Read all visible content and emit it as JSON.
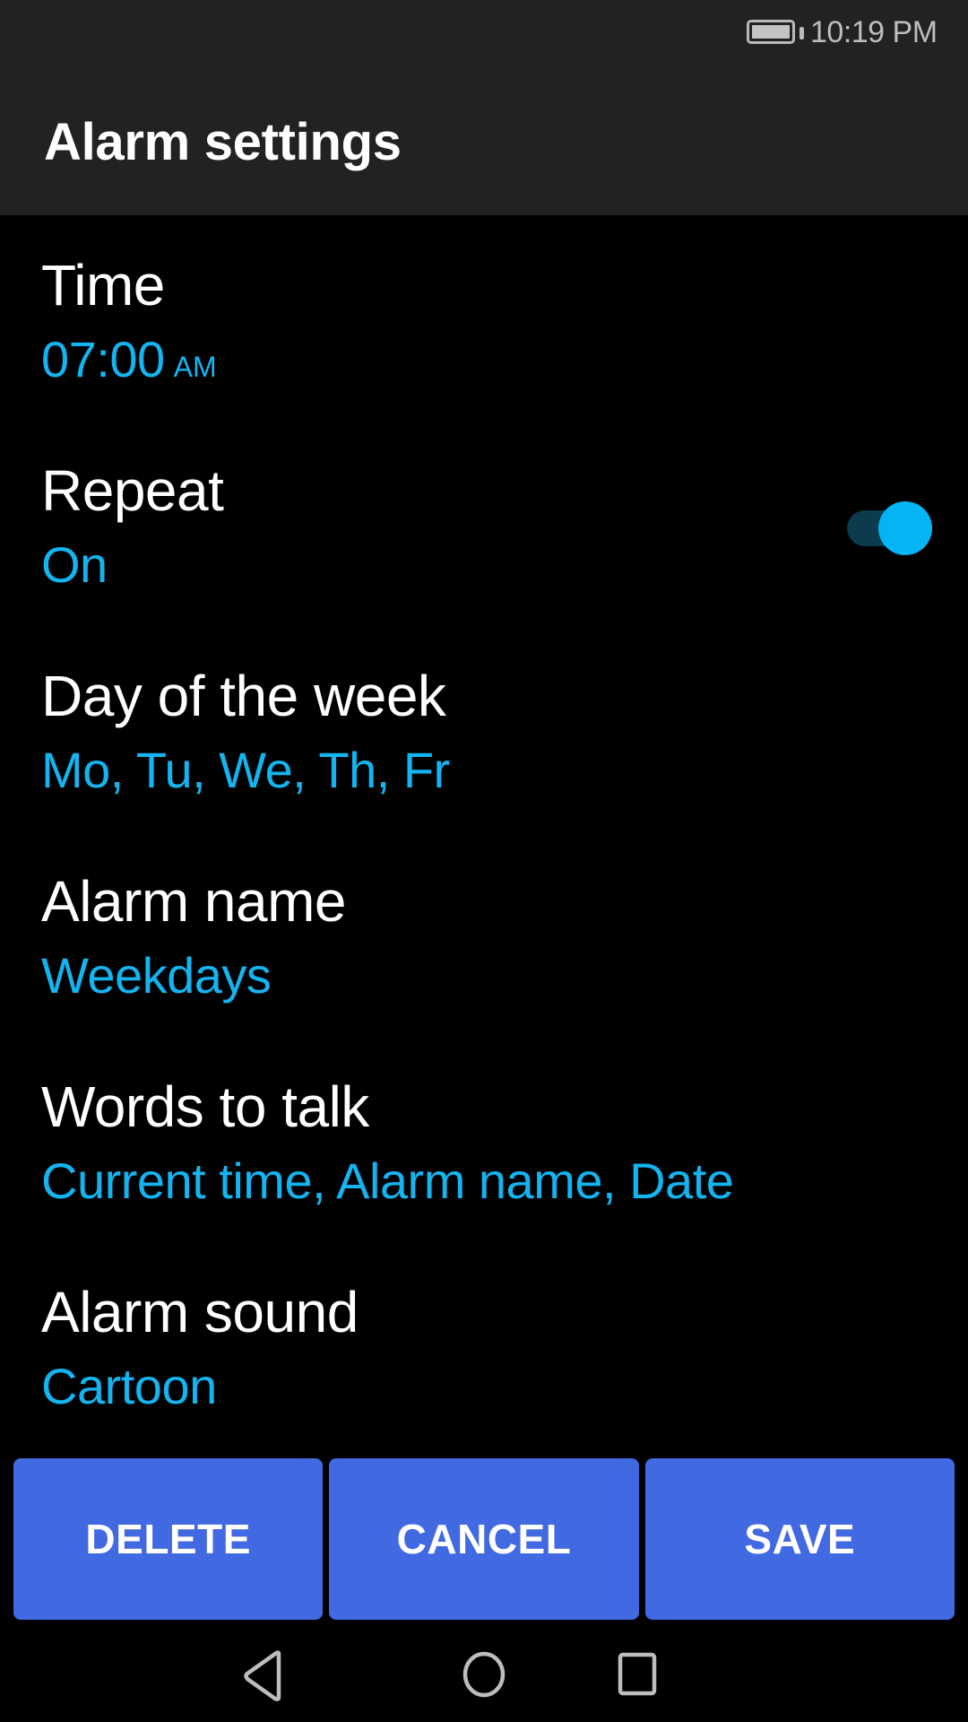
{
  "status_bar": {
    "battery_icon": "battery-full-icon",
    "time": "10:19 PM"
  },
  "app_bar": {
    "title": "Alarm settings"
  },
  "settings": [
    {
      "id": "time",
      "label": "Time",
      "value": "07:00",
      "suffix": "AM"
    },
    {
      "id": "repeat",
      "label": "Repeat",
      "value": "On",
      "toggle_on": true
    },
    {
      "id": "day-of-week",
      "label": "Day of the week",
      "value": "Mo, Tu, We, Th, Fr"
    },
    {
      "id": "alarm-name",
      "label": "Alarm name",
      "value": "Weekdays"
    },
    {
      "id": "words-to-talk",
      "label": "Words to talk",
      "value": "Current time, Alarm name, Date"
    },
    {
      "id": "alarm-sound",
      "label": "Alarm sound",
      "value": "Cartoon"
    }
  ],
  "actions": {
    "delete_label": "DELETE",
    "cancel_label": "CANCEL",
    "save_label": "SAVE"
  },
  "nav_bar": {
    "back_icon": "back-triangle-icon",
    "home_icon": "home-circle-icon",
    "recents_icon": "recents-square-icon"
  },
  "colors": {
    "header_bg": "#222222",
    "background": "#000000",
    "accent_value": "#13b4f0",
    "toggle_thumb": "#03b5f5",
    "toggle_track": "#0b3b4c",
    "button_bg": "#4169e1",
    "text_primary": "#ffffff",
    "system_icons": "#bdbdbd"
  }
}
